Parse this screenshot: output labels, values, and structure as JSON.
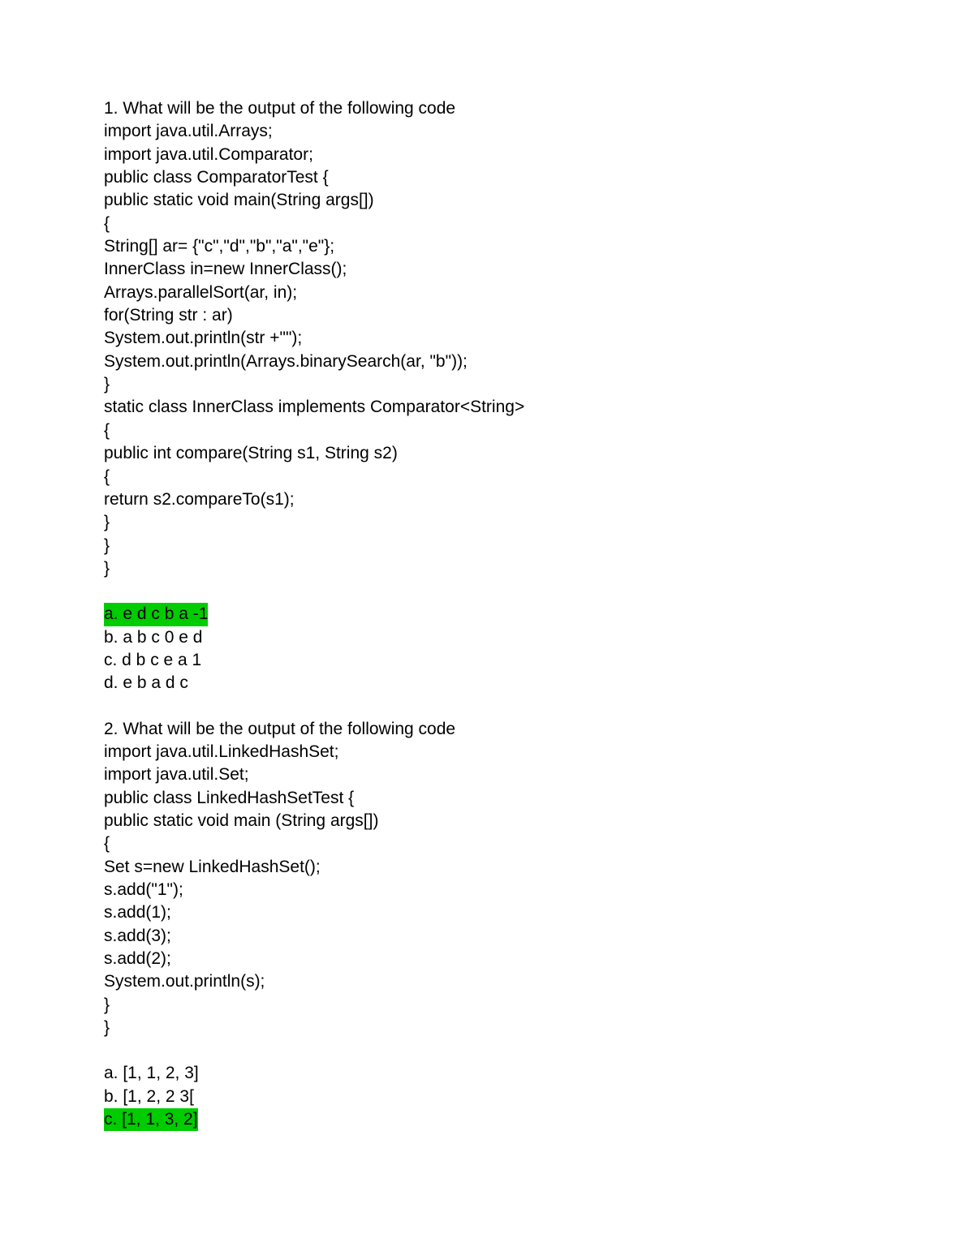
{
  "q1": {
    "title": "1. What will be the output of the following code",
    "code": [
      "import java.util.Arrays;",
      "import java.util.Comparator;",
      "public class ComparatorTest {",
      "public static void main(String args[])",
      "{",
      "String[] ar= {\"c\",\"d\",\"b\",\"a\",\"e\"};",
      "InnerClass in=new InnerClass();",
      "Arrays.parallelSort(ar, in);",
      "for(String str : ar)",
      "System.out.println(str +\"\");",
      "System.out.println(Arrays.binarySearch(ar, \"b\"));",
      "}",
      "static class InnerClass implements Comparator<String>",
      "{",
      "public int compare(String s1, String s2)",
      "{",
      "return s2.compareTo(s1);",
      "}",
      "}",
      "}"
    ],
    "options": {
      "a": "a. e d c b a -1",
      "b": "b. a b c 0 e d",
      "c": "c. d b c e a 1",
      "d": "d. e b a d c"
    },
    "correct": "a"
  },
  "q2": {
    "title": "2. What will be the output of the following code",
    "code": [
      "import java.util.LinkedHashSet;",
      "import java.util.Set;",
      "public class LinkedHashSetTest {",
      "public static void main (String args[])",
      "{",
      "Set s=new LinkedHashSet();",
      "s.add(\"1\");",
      "s.add(1);",
      "s.add(3);",
      "s.add(2);",
      "System.out.println(s);",
      "}",
      "}"
    ],
    "options": {
      "a": "a. [1, 1, 2, 3]",
      "b": "b. [1, 2, 2 3[",
      "c": "c. [1, 1, 3, 2]"
    },
    "correct": "c"
  }
}
